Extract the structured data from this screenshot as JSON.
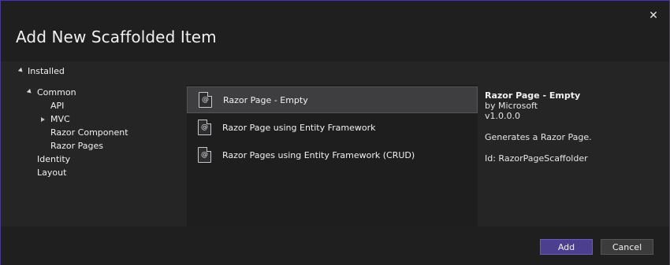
{
  "dialog": {
    "title": "Add New Scaffolded Item",
    "close_glyph": "✕"
  },
  "tree": {
    "root_label": "Installed",
    "common_label": "Common",
    "items": {
      "api": "API",
      "mvc": "MVC",
      "razor_component": "Razor Component",
      "razor_pages": "Razor Pages",
      "identity": "Identity",
      "layout": "Layout"
    }
  },
  "templates": [
    {
      "label": "Razor Page - Empty",
      "icon": "razor-file-icon",
      "icon_glyph": "@"
    },
    {
      "label": "Razor Page using Entity Framework",
      "icon": "razor-file-icon",
      "icon_glyph": "@"
    },
    {
      "label": "Razor Pages using Entity Framework (CRUD)",
      "icon": "razor-file-icon",
      "icon_glyph": "@"
    }
  ],
  "details": {
    "name": "Razor Page - Empty",
    "author": "by Microsoft",
    "version": "v1.0.0.0",
    "description": "Generates a Razor Page.",
    "id": "Id: RazorPageScaffolder"
  },
  "buttons": {
    "add": "Add",
    "cancel": "Cancel"
  },
  "colors": {
    "accent": "#4c3f8f",
    "dialog_border": "#4a3a8c"
  }
}
